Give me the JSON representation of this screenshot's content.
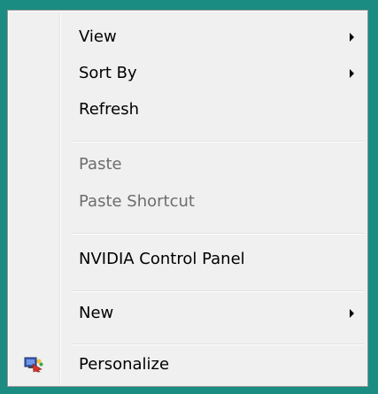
{
  "menu": {
    "items": [
      {
        "label": "View",
        "has_submenu": true,
        "enabled": true
      },
      {
        "label": "Sort By",
        "has_submenu": true,
        "enabled": true
      },
      {
        "label": "Refresh",
        "has_submenu": false,
        "enabled": true
      },
      {
        "label": "Paste",
        "has_submenu": false,
        "enabled": false
      },
      {
        "label": "Paste Shortcut",
        "has_submenu": false,
        "enabled": false
      },
      {
        "label": "NVIDIA Control Panel",
        "has_submenu": false,
        "enabled": true
      },
      {
        "label": "New",
        "has_submenu": true,
        "enabled": true
      },
      {
        "label": "Personalize",
        "has_submenu": false,
        "enabled": true,
        "icon": "personalize-display-icon"
      }
    ]
  },
  "colors": {
    "desktop_background": "#1a8c82",
    "menu_background": "#f0f0f0",
    "menu_border": "#979797",
    "disabled_text": "#6d6d6d"
  }
}
